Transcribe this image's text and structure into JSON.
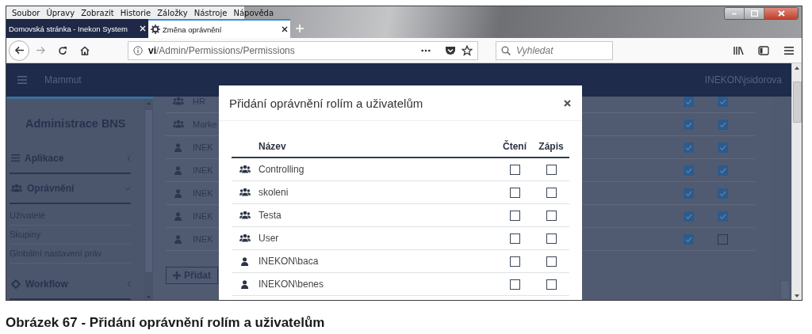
{
  "browser": {
    "menu": [
      "Soubor",
      "Úpravy",
      "Zobrazit",
      "Historie",
      "Záložky",
      "Nástroje",
      "Nápověda"
    ],
    "tabs": [
      {
        "title": "Domovská stránka - Inekon System",
        "selected": false
      },
      {
        "title": "Změna oprávnění",
        "selected": true
      }
    ],
    "url": {
      "host": "vi",
      "path": "/Admin/Permissions/Permissions"
    },
    "search": {
      "placeholder": "Vyhledat"
    }
  },
  "app": {
    "brand": "Mammut",
    "user": "INEKON\\jsidorova"
  },
  "sidebar": {
    "title": "Administrace BNS",
    "sections": [
      {
        "label": "Aplikace",
        "kind": "list",
        "expanded": false
      },
      {
        "label": "Oprávnění",
        "kind": "group",
        "expanded": true,
        "children": [
          "Uživatelé",
          "Skupiny",
          "Globální nastavení práv"
        ]
      },
      {
        "label": "Workflow",
        "kind": "diamond",
        "expanded": false
      }
    ]
  },
  "permissions": {
    "rows": [
      {
        "kind": "group",
        "name": "HR",
        "read": true,
        "write": true
      },
      {
        "kind": "group",
        "name": "Marke",
        "read": true,
        "write": true
      },
      {
        "kind": "user",
        "name": "INEK",
        "read": true,
        "write": true
      },
      {
        "kind": "user",
        "name": "INEK",
        "read": true,
        "write": true
      },
      {
        "kind": "user",
        "name": "INEK",
        "read": true,
        "write": true
      },
      {
        "kind": "user",
        "name": "INEK",
        "read": true,
        "write": true
      },
      {
        "kind": "user",
        "name": "INEK",
        "read": true,
        "write": false
      }
    ],
    "add_button": "Přidat"
  },
  "dialog": {
    "title": "Přidání oprávnění rolím a uživatelům",
    "columns": [
      "Název",
      "Čtení",
      "Zápis"
    ],
    "rows": [
      {
        "kind": "group",
        "name": "Controlling",
        "read": false,
        "write": false
      },
      {
        "kind": "group",
        "name": "skoleni",
        "read": false,
        "write": false
      },
      {
        "kind": "group",
        "name": "Testa",
        "read": false,
        "write": false
      },
      {
        "kind": "group",
        "name": "User",
        "read": false,
        "write": false
      },
      {
        "kind": "user",
        "name": "INEKON\\baca",
        "read": false,
        "write": false
      },
      {
        "kind": "user",
        "name": "INEKON\\benes",
        "read": false,
        "write": false
      }
    ]
  },
  "caption": "Obrázek 67 - Přidání oprávnění rolím a uživatelům"
}
